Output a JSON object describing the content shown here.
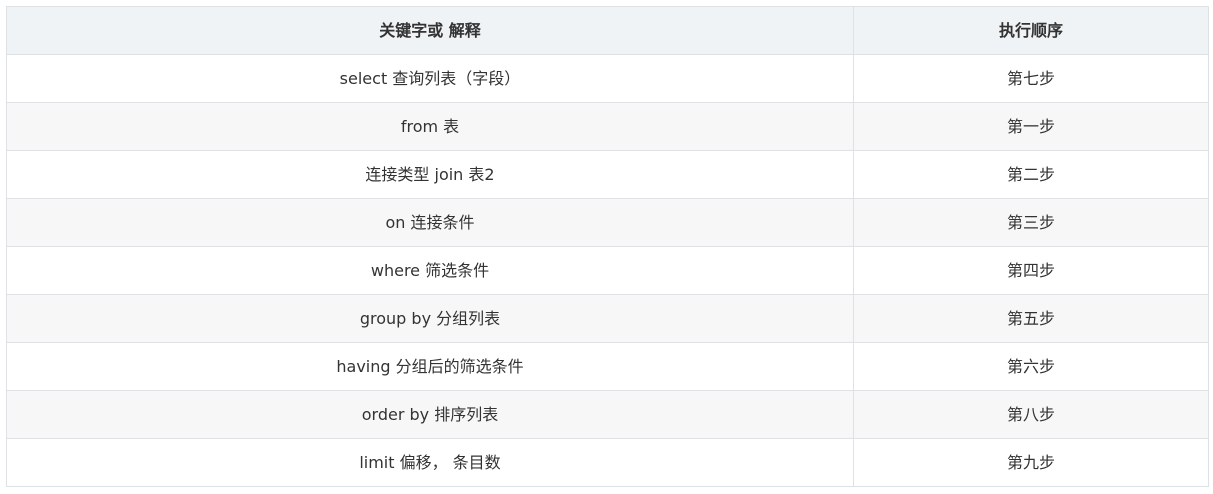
{
  "table": {
    "headers": [
      "关键字或 解释",
      "执行顺序"
    ],
    "rows": [
      [
        "select 查询列表（字段）",
        "第七步"
      ],
      [
        "from 表",
        "第一步"
      ],
      [
        "连接类型 join 表2",
        "第二步"
      ],
      [
        "on 连接条件",
        "第三步"
      ],
      [
        "where 筛选条件",
        "第四步"
      ],
      [
        "group by 分组列表",
        "第五步"
      ],
      [
        "having 分组后的筛选条件",
        "第六步"
      ],
      [
        "order by 排序列表",
        "第八步"
      ],
      [
        "limit 偏移， 条目数",
        "第九步"
      ]
    ]
  },
  "colors": {
    "header_bg": "#eff3f5",
    "row_alt_bg": "#f7f7f7",
    "border": "#dfe2e5",
    "text": "#333333"
  }
}
